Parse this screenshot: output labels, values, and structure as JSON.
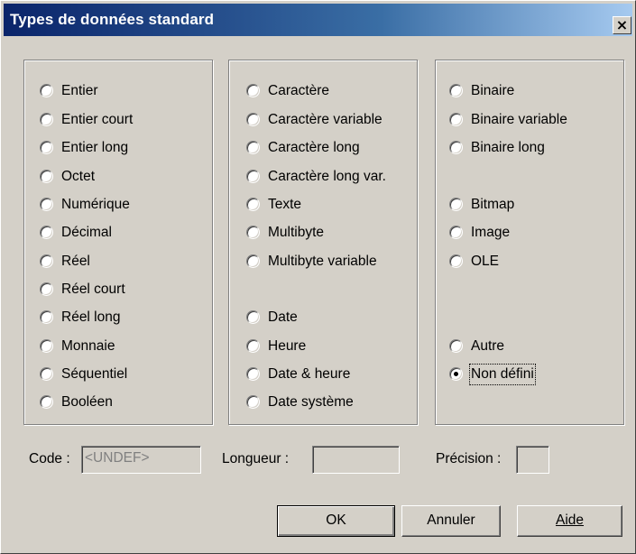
{
  "dialog": {
    "title": "Types de données standard",
    "close_label": "×"
  },
  "groups": [
    {
      "items": [
        {
          "label": "Entier",
          "selected": false
        },
        {
          "label": "Entier court",
          "selected": false
        },
        {
          "label": "Entier long",
          "selected": false
        },
        {
          "label": "Octet",
          "selected": false
        },
        {
          "label": "Numérique",
          "selected": false
        },
        {
          "label": "Décimal",
          "selected": false
        },
        {
          "label": "Réel",
          "selected": false
        },
        {
          "label": "Réel court",
          "selected": false
        },
        {
          "label": "Réel long",
          "selected": false
        },
        {
          "label": "Monnaie",
          "selected": false
        },
        {
          "label": "Séquentiel",
          "selected": false
        },
        {
          "label": "Booléen",
          "selected": false
        }
      ]
    },
    {
      "items": [
        {
          "label": "Caractère",
          "selected": false
        },
        {
          "label": "Caractère variable",
          "selected": false
        },
        {
          "label": "Caractère long",
          "selected": false
        },
        {
          "label": "Caractère long var.",
          "selected": false
        },
        {
          "label": "Texte",
          "selected": false
        },
        {
          "label": "Multibyte",
          "selected": false
        },
        {
          "label": "Multibyte variable",
          "selected": false
        },
        {
          "label": "Date",
          "selected": false
        },
        {
          "label": "Heure",
          "selected": false
        },
        {
          "label": "Date & heure",
          "selected": false
        },
        {
          "label": "Date système",
          "selected": false
        }
      ]
    },
    {
      "items": [
        {
          "label": "Binaire",
          "selected": false
        },
        {
          "label": "Binaire variable",
          "selected": false
        },
        {
          "label": "Binaire long",
          "selected": false
        },
        {
          "label": "Bitmap",
          "selected": false
        },
        {
          "label": "Image",
          "selected": false
        },
        {
          "label": "OLE",
          "selected": false
        },
        {
          "label": "Autre",
          "selected": false
        },
        {
          "label": "Non défini",
          "selected": true
        }
      ]
    }
  ],
  "fields": {
    "code_label": "Code :",
    "code_value": "<UNDEF>",
    "length_label": "Longueur :",
    "length_value": "",
    "precision_label": "Précision :",
    "precision_value": ""
  },
  "buttons": {
    "ok": "OK",
    "cancel": "Annuler",
    "help": "Aide"
  }
}
